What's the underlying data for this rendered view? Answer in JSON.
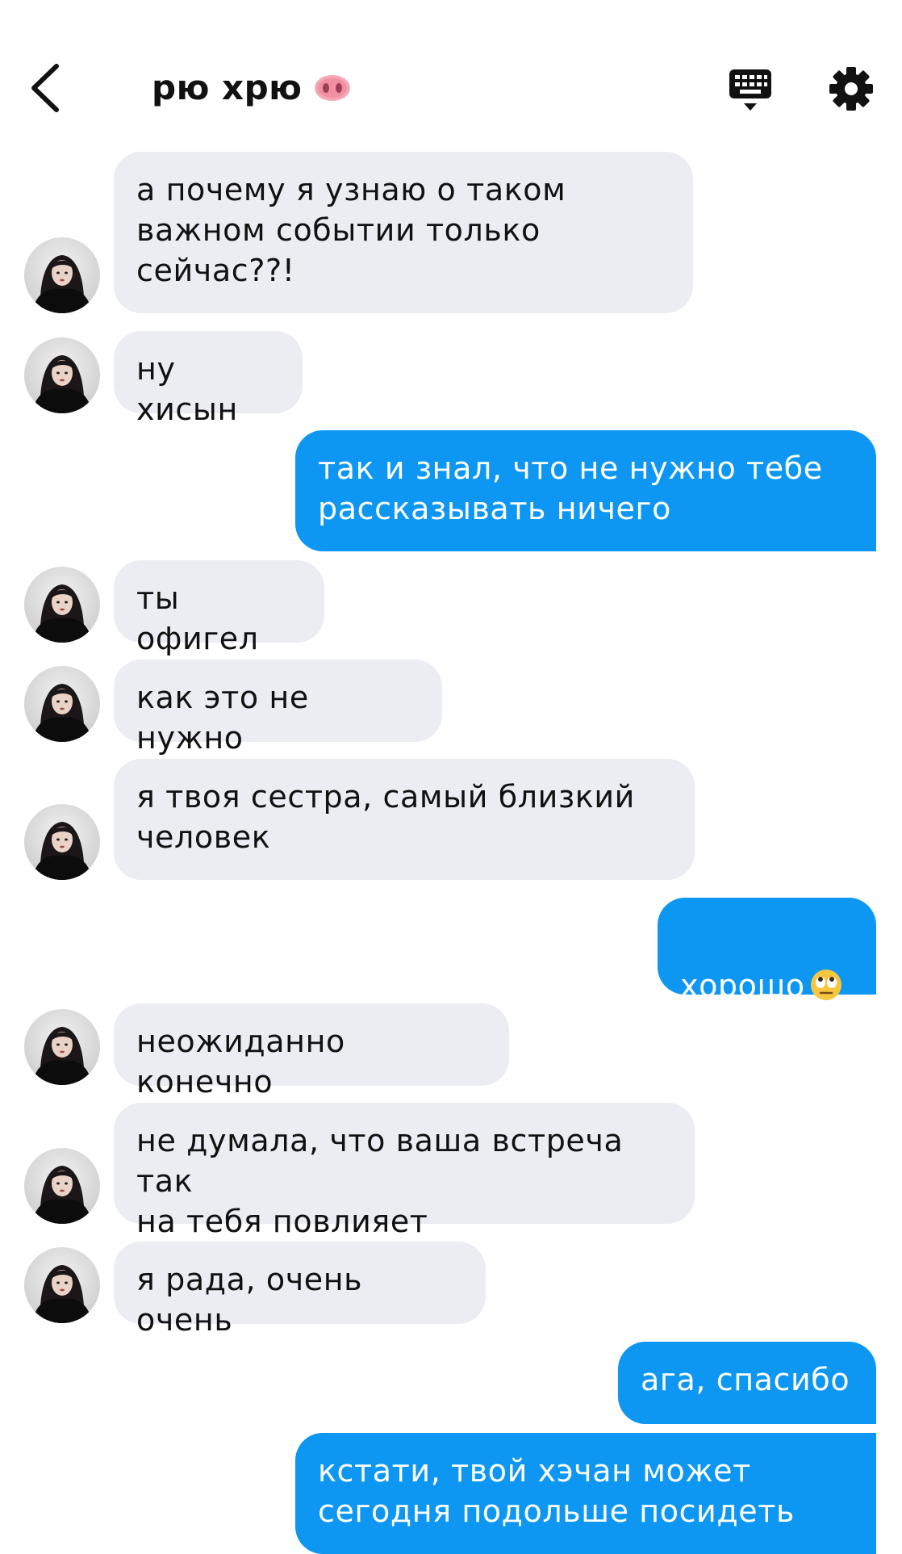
{
  "header": {
    "title": "рю хрю",
    "title_emoji": "pig-nose-icon",
    "back_icon": "back-chevron-icon",
    "keyboard_icon": "keyboard-icon",
    "settings_icon": "gear-icon"
  },
  "colors": {
    "incoming_bubble": "#ebedf2",
    "outgoing_bubble": "#0d97f2",
    "outgoing_text": "#ffffff",
    "incoming_text": "#111111"
  },
  "messages": [
    {
      "from": "them",
      "text": "а почему я узнаю о таком\nважном событии только\nсейчас??!"
    },
    {
      "from": "them",
      "text": "ну хисын"
    },
    {
      "from": "me",
      "text": "так и знал, что не нужно тебе\nрассказывать ничего"
    },
    {
      "from": "them",
      "text": "ты офигел"
    },
    {
      "from": "them",
      "text": "как это не нужно"
    },
    {
      "from": "them",
      "text": "я твоя сестра, самый близкий\nчеловек"
    },
    {
      "from": "me",
      "text": "хорошо",
      "emoji": "rolling-eyes-emoji-icon"
    },
    {
      "from": "them",
      "text": "неожиданно конечно"
    },
    {
      "from": "them",
      "text": "не думала, что ваша встреча так\nна тебя повлияет"
    },
    {
      "from": "them",
      "text": "я рада, очень очень"
    },
    {
      "from": "me",
      "text": "ага, спасибо"
    },
    {
      "from": "me",
      "text": "кстати, твой хэчан может\nсегодня подольше посидеть"
    }
  ]
}
